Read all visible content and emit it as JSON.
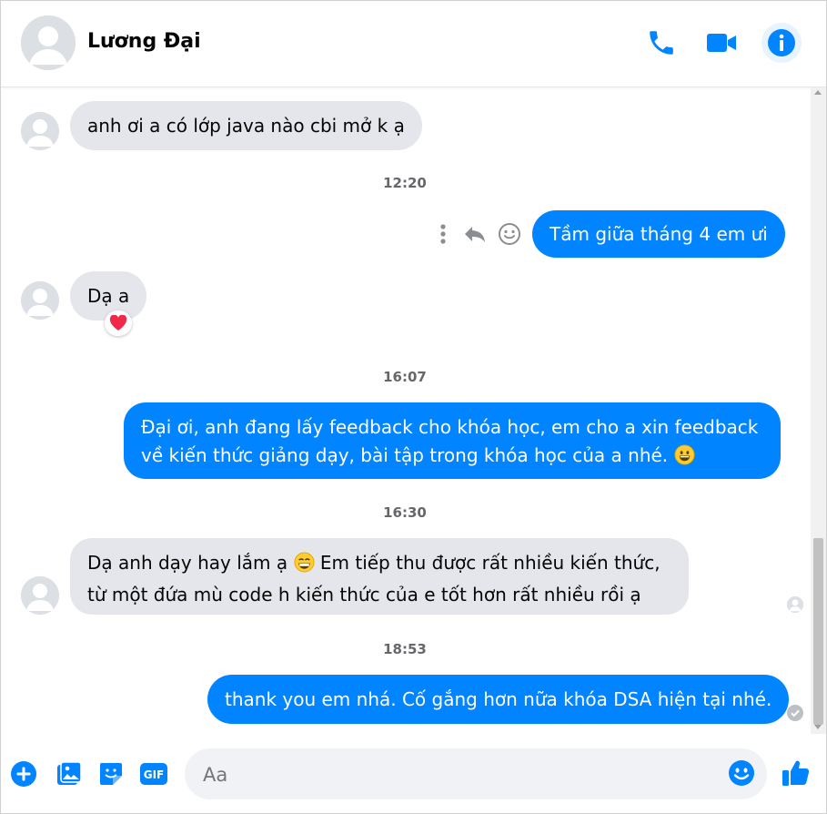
{
  "header": {
    "contact_name": "Lương Đại",
    "icons": [
      "phone-icon",
      "video-camera-icon",
      "info-icon"
    ]
  },
  "messages": [
    {
      "from": "them",
      "text": "anh ơi a có lớp java nào cbi mở k ạ"
    },
    {
      "time": "12:20"
    },
    {
      "from": "me",
      "text": "Tầm giữa tháng 4 em ưi"
    },
    {
      "from": "them",
      "text": "Dạ a",
      "reaction": "heart"
    },
    {
      "time": "16:07"
    },
    {
      "from": "me",
      "lines": [
        "Đại ơi, anh đang lấy feedback cho khóa học, em cho a xin feedback",
        "về kiến thức giảng dạy, bài tập trong khóa học của a nhé."
      ],
      "emoji": "grinning-face"
    },
    {
      "time": "16:30"
    },
    {
      "from": "them",
      "lines": [
        "Dạ anh dạy hay lắm ạ",
        "Em tiếp thu được rất nhiều kiến thức,",
        "từ một đứa mù code h kiến thức của e tốt hơn rất nhiều rồi ạ"
      ],
      "emoji": "beaming-face"
    },
    {
      "time": "18:53"
    },
    {
      "from": "me",
      "text": "thank you em nhá. Cố gắng hơn nữa khóa DSA hiện tại nhé."
    }
  ],
  "composer": {
    "placeholder": "Aa",
    "icons": [
      "plus-icon",
      "image-icon",
      "sticker-icon",
      "gif-icon",
      "emoji-icon",
      "thumbs-up-icon"
    ],
    "gif_label": "GIF"
  },
  "colors": {
    "accent": "#0084ff",
    "incoming_bubble": "#e4e6eb",
    "reaction_heart": "#f02849"
  }
}
